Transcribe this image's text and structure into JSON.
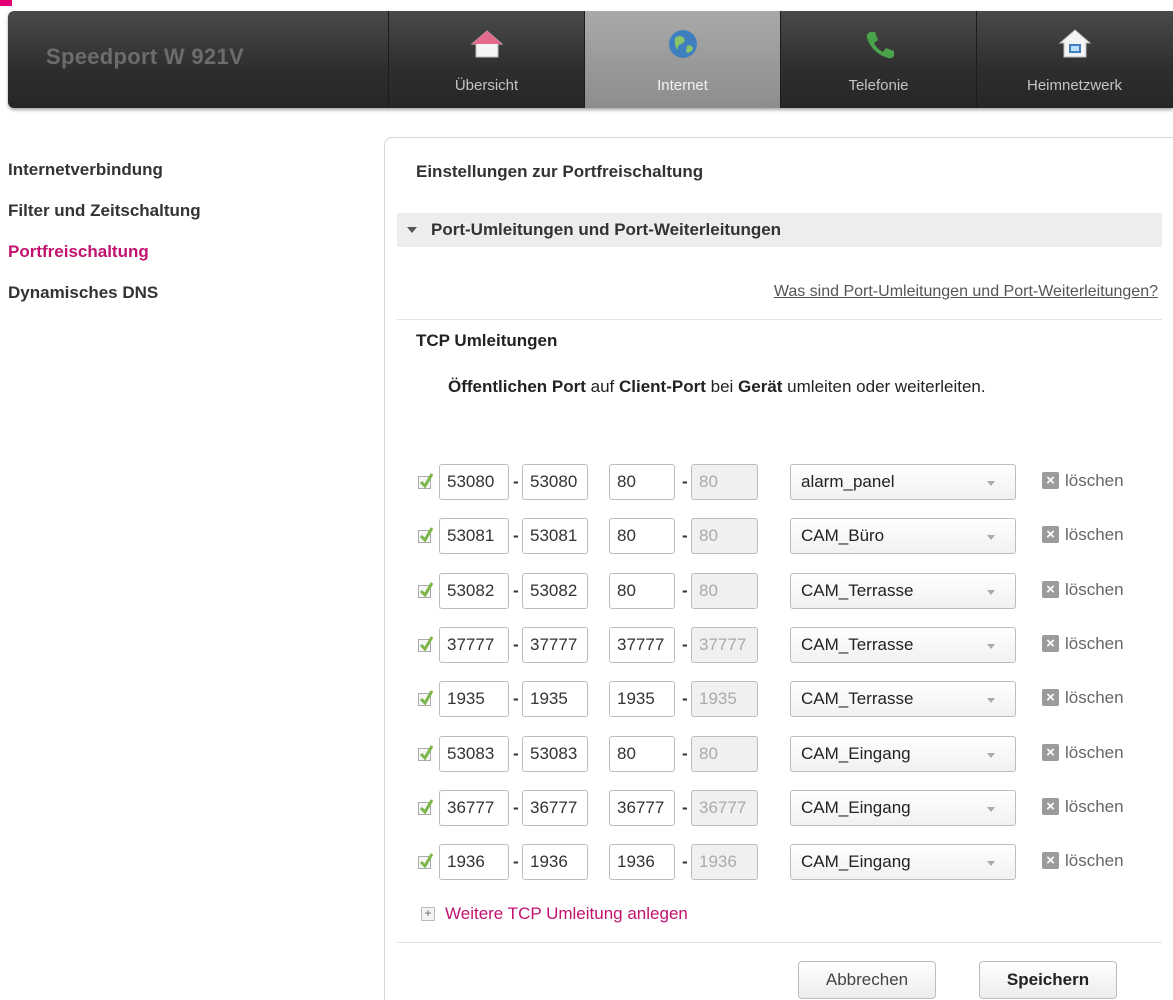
{
  "header": {
    "brand": "Speedport W 921V",
    "tabs": [
      {
        "label": "Übersicht",
        "icon": "house-icon"
      },
      {
        "label": "Internet",
        "icon": "globe-icon",
        "active": true
      },
      {
        "label": "Telefonie",
        "icon": "phone-icon"
      },
      {
        "label": "Heimnetzwerk",
        "icon": "home-network-icon"
      }
    ]
  },
  "sidebar": {
    "items": [
      {
        "label": "Internetverbindung"
      },
      {
        "label": "Filter und Zeitschaltung"
      },
      {
        "label": "Portfreischaltung",
        "active": true
      },
      {
        "label": "Dynamisches DNS"
      }
    ]
  },
  "main": {
    "title": "Einstellungen zur Portfreischaltung",
    "section_title": "Port-Umleitungen und Port-Weiterleitungen",
    "help_link": "Was sind Port-Umleitungen und Port-Weiterleitungen?",
    "subhead": "TCP Umleitungen",
    "desc": {
      "p1": "Öffentlichen Port",
      "p2": " auf ",
      "p3": "Client-Port",
      "p4": " bei ",
      "p5": "Gerät",
      "p6": " umleiten oder weiterleiten."
    },
    "rows": [
      {
        "checked": true,
        "pub_from": "53080",
        "pub_to": "53080",
        "cli_from": "80",
        "cli_to": "80",
        "device": "alarm_panel",
        "delete": "löschen"
      },
      {
        "checked": true,
        "pub_from": "53081",
        "pub_to": "53081",
        "cli_from": "80",
        "cli_to": "80",
        "device": "CAM_Büro",
        "delete": "löschen"
      },
      {
        "checked": true,
        "pub_from": "53082",
        "pub_to": "53082",
        "cli_from": "80",
        "cli_to": "80",
        "device": "CAM_Terrasse",
        "delete": "löschen"
      },
      {
        "checked": true,
        "pub_from": "37777",
        "pub_to": "37777",
        "cli_from": "37777",
        "cli_to": "37777",
        "device": "CAM_Terrasse",
        "delete": "löschen"
      },
      {
        "checked": true,
        "pub_from": "1935",
        "pub_to": "1935",
        "cli_from": "1935",
        "cli_to": "1935",
        "device": "CAM_Terrasse",
        "delete": "löschen"
      },
      {
        "checked": true,
        "pub_from": "53083",
        "pub_to": "53083",
        "cli_from": "80",
        "cli_to": "80",
        "device": "CAM_Eingang",
        "delete": "löschen"
      },
      {
        "checked": true,
        "pub_from": "36777",
        "pub_to": "36777",
        "cli_from": "36777",
        "cli_to": "36777",
        "device": "CAM_Eingang",
        "delete": "löschen"
      },
      {
        "checked": true,
        "pub_from": "1936",
        "pub_to": "1936",
        "cli_from": "1936",
        "cli_to": "1936",
        "device": "CAM_Eingang",
        "delete": "löschen"
      }
    ],
    "add_more": "Weitere TCP Umleitung anlegen",
    "cancel_button": "Abbrechen",
    "save_button": "Speichern"
  },
  "colors": {
    "accent": "#c2126e",
    "header_bg": "#2e2e2e",
    "active_tab": "#9a9a9a"
  }
}
